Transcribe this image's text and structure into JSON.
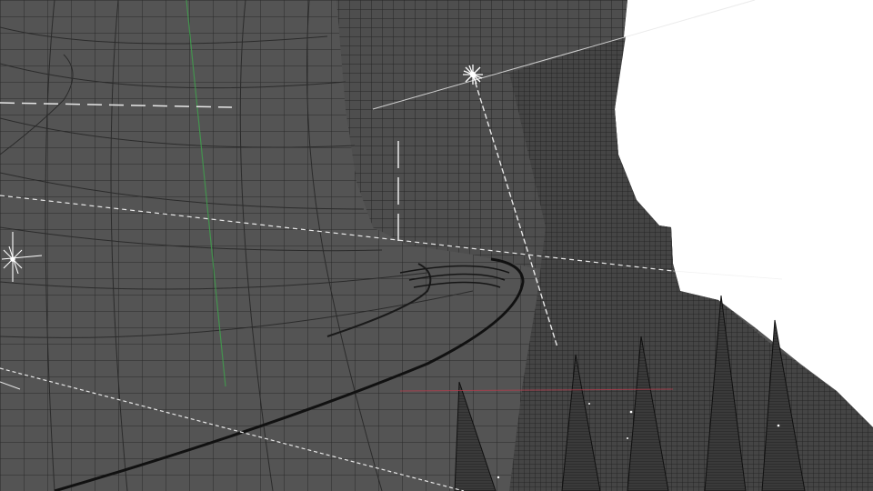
{
  "viewport": {
    "background_color": "#ffffff",
    "mesh_fill_color": "#545454",
    "mesh_dense_color": "#3a3a3a",
    "mesh_line_color": "#1c1c1c",
    "guide_line_color": "#e8e8e8",
    "axis_green_color": "#3fa34d",
    "axis_red_color": "#c0394b",
    "light_icon_color": "#ffffff"
  },
  "icons": {
    "light_1": "sun-light-icon",
    "light_2": "point-light-icon"
  }
}
